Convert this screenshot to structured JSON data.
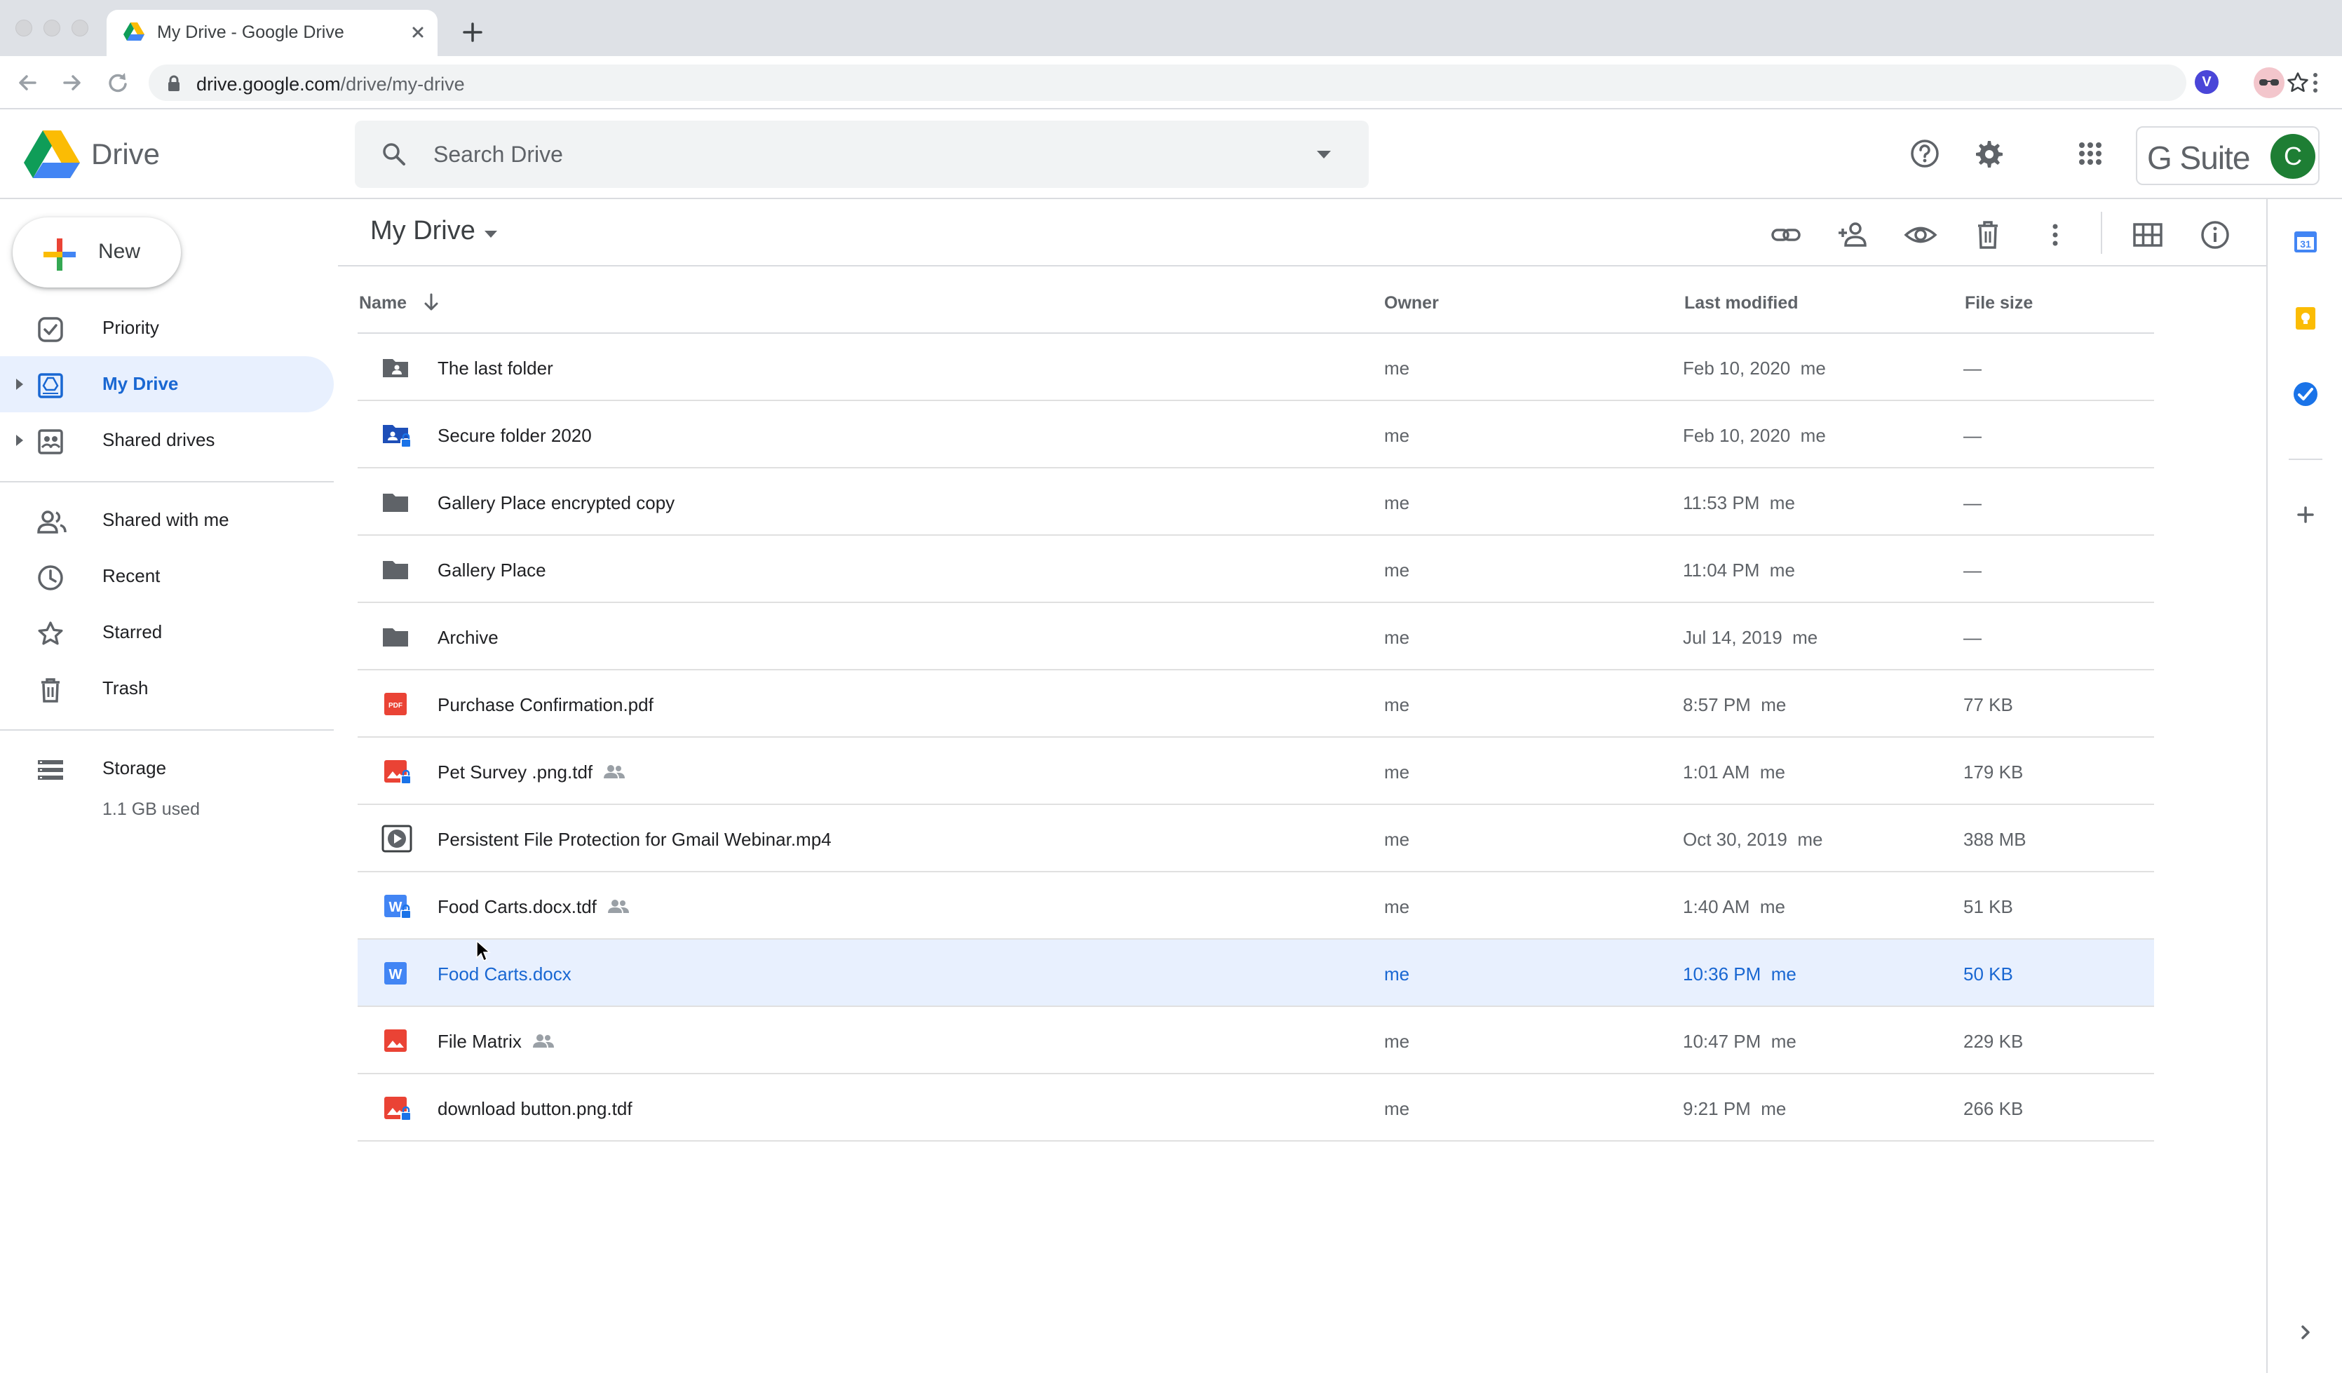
{
  "browser": {
    "tab_title": "My Drive - Google Drive",
    "url_host": "drive.google.com",
    "url_path": "/drive/my-drive"
  },
  "header": {
    "app_name": "Drive",
    "search_placeholder": "Search Drive",
    "suite_label": "G Suite",
    "account_initial": "C"
  },
  "sidebar": {
    "new_label": "New",
    "items": [
      {
        "label": "Priority",
        "icon": "priority-icon"
      },
      {
        "label": "My Drive",
        "icon": "my-drive-icon",
        "active": true
      },
      {
        "label": "Shared drives",
        "icon": "shared-drives-icon"
      },
      {
        "label": "Shared with me",
        "icon": "shared-with-me-icon"
      },
      {
        "label": "Recent",
        "icon": "clock-icon"
      },
      {
        "label": "Starred",
        "icon": "star-icon"
      },
      {
        "label": "Trash",
        "icon": "trash-icon"
      },
      {
        "label": "Storage",
        "icon": "storage-icon"
      }
    ],
    "storage_used": "1.1 GB used"
  },
  "main": {
    "location_title": "My Drive",
    "columns": {
      "name": "Name",
      "owner": "Owner",
      "last_modified": "Last modified",
      "file_size": "File size"
    },
    "files": [
      {
        "name": "The last folder",
        "type": "shared-folder",
        "owner": "me",
        "modified": "Feb 10, 2020  me",
        "size": "—"
      },
      {
        "name": "Secure folder 2020",
        "type": "secure-folder",
        "owner": "me",
        "modified": "Feb 10, 2020  me",
        "size": "—"
      },
      {
        "name": "Gallery Place encrypted copy",
        "type": "folder",
        "owner": "me",
        "modified": "11:53 PM  me",
        "size": "—"
      },
      {
        "name": "Gallery Place",
        "type": "folder",
        "owner": "me",
        "modified": "11:04 PM  me",
        "size": "—"
      },
      {
        "name": "Archive",
        "type": "folder",
        "owner": "me",
        "modified": "Jul 14, 2019  me",
        "size": "—"
      },
      {
        "name": "Purchase Confirmation.pdf",
        "type": "pdf",
        "owner": "me",
        "modified": "8:57 PM  me",
        "size": "77 KB"
      },
      {
        "name": "Pet Survey .png.tdf",
        "type": "image-locked",
        "shared": true,
        "owner": "me",
        "modified": "1:01 AM  me",
        "size": "179 KB"
      },
      {
        "name": "Persistent File Protection for Gmail Webinar.mp4",
        "type": "video",
        "owner": "me",
        "modified": "Oct 30, 2019  me",
        "size": "388 MB"
      },
      {
        "name": "Food Carts.docx.tdf",
        "type": "word-locked",
        "shared": true,
        "owner": "me",
        "modified": "1:40 AM  me",
        "size": "51 KB"
      },
      {
        "name": "Food Carts.docx",
        "type": "word",
        "selected": true,
        "owner": "me",
        "modified": "10:36 PM  me",
        "size": "50 KB"
      },
      {
        "name": "File Matrix",
        "type": "image",
        "shared": true,
        "owner": "me",
        "modified": "10:47 PM  me",
        "size": "229 KB"
      },
      {
        "name": "download button.png.tdf",
        "type": "image-locked",
        "owner": "me",
        "modified": "9:21 PM  me",
        "size": "266 KB"
      }
    ]
  },
  "side_panel": {
    "calendar_day": "31"
  },
  "colors": {
    "accent_blue": "#1967d2",
    "selected_bg": "#e8f0fe",
    "folder_grey": "#5f6368",
    "file_red": "#ea4335",
    "word_blue": "#4285f4",
    "avatar_green": "#1e7e34"
  }
}
